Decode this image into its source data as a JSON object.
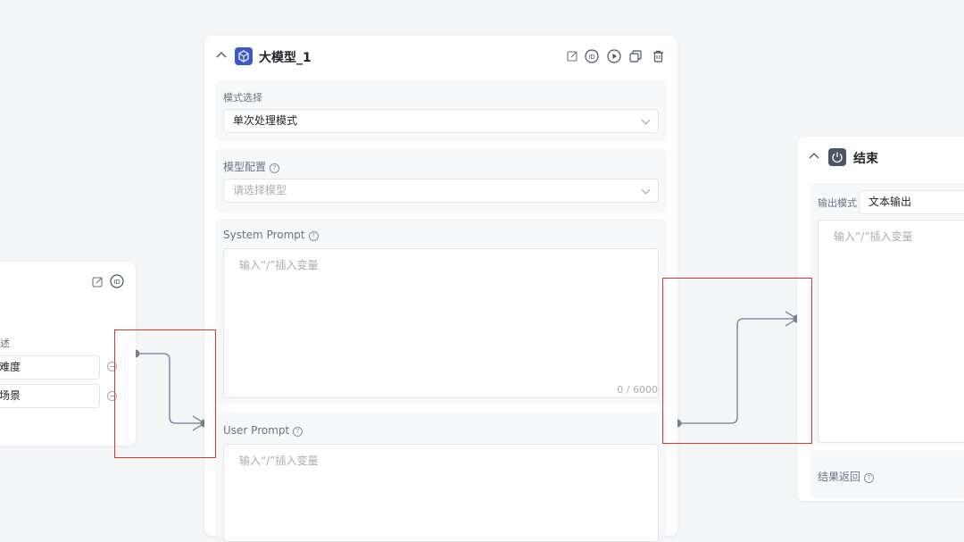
{
  "left_node": {
    "desc_label_partial": "述",
    "rows": [
      {
        "value": "难度"
      },
      {
        "value": "场景"
      }
    ]
  },
  "llm_node": {
    "title": "大模型_1",
    "mode": {
      "label": "模式选择",
      "value": "单次处理模式"
    },
    "model_config": {
      "label": "模型配置",
      "placeholder": "请选择模型"
    },
    "system_prompt": {
      "label": "System Prompt",
      "placeholder": "输入“/”插入变量",
      "counter": "0 / 6000"
    },
    "user_prompt": {
      "label": "User Prompt",
      "placeholder": "输入“/”插入变量"
    }
  },
  "end_node": {
    "title": "结束",
    "output_mode": {
      "label": "输出模式",
      "value": "文本输出"
    },
    "content_placeholder": "输入“/”插入变量",
    "result_return_label": "结果返回"
  },
  "colors": {
    "accent": "#3a57d6",
    "end_icon_bg": "#4b5563",
    "edge": "#8a8fa8",
    "highlight": "#e0352b"
  },
  "icons": [
    "edit-icon",
    "id-icon",
    "play-icon",
    "copy-icon",
    "delete-icon",
    "chevron-up-icon",
    "chevron-down-icon",
    "help-icon",
    "power-icon",
    "cube-icon",
    "minus-circle-icon"
  ]
}
